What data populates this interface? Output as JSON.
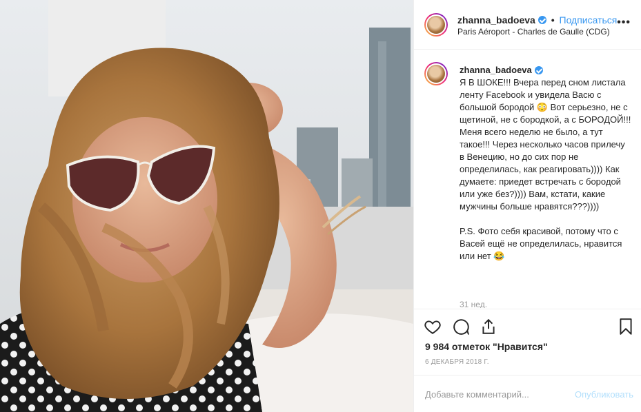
{
  "post": {
    "username": "zhanna_badoeva",
    "follow_label": "Подписаться",
    "dot": "•",
    "location": "Paris Aéroport - Charles de Gaulle (CDG)",
    "more_icon": "more-options-icon",
    "more_glyph": "•••"
  },
  "caption": {
    "username": "zhanna_badoeva",
    "text": "Я В ШОКЕ!!! Вчера перед сном листала ленту Facebook и увидела Васю с большой бородой 😳 Вот серьезно, не с щетиной, не с бородкой, а с БОРОДОЙ!!! Меня всего неделю не было, а тут такое!!! Через несколько часов прилечу в Венецию, но до сих пор не определилась, как реагировать)))) Как думаете: приедет встречать с бородой или уже без?)))) Вам, кстати, какие мужчины больше нравятся???))))\n\nP.S. Фото себя красивой, потому что с Васей ещё не определилась, нравится или нет 😂",
    "time": "31 нед."
  },
  "actions": {
    "like_icon": "heart-icon",
    "comment_icon": "comment-icon",
    "share_icon": "share-icon",
    "save_icon": "bookmark-icon"
  },
  "likes": "9 984 отметок \"Нравится\"",
  "date": "6 ДЕКАБРЯ 2018 Г.",
  "comment_box": {
    "placeholder": "Добавьте комментарий...",
    "publish_label": "Опубликовать"
  },
  "colors": {
    "accent": "#3897f0",
    "border": "#efefef",
    "muted": "#999999"
  }
}
